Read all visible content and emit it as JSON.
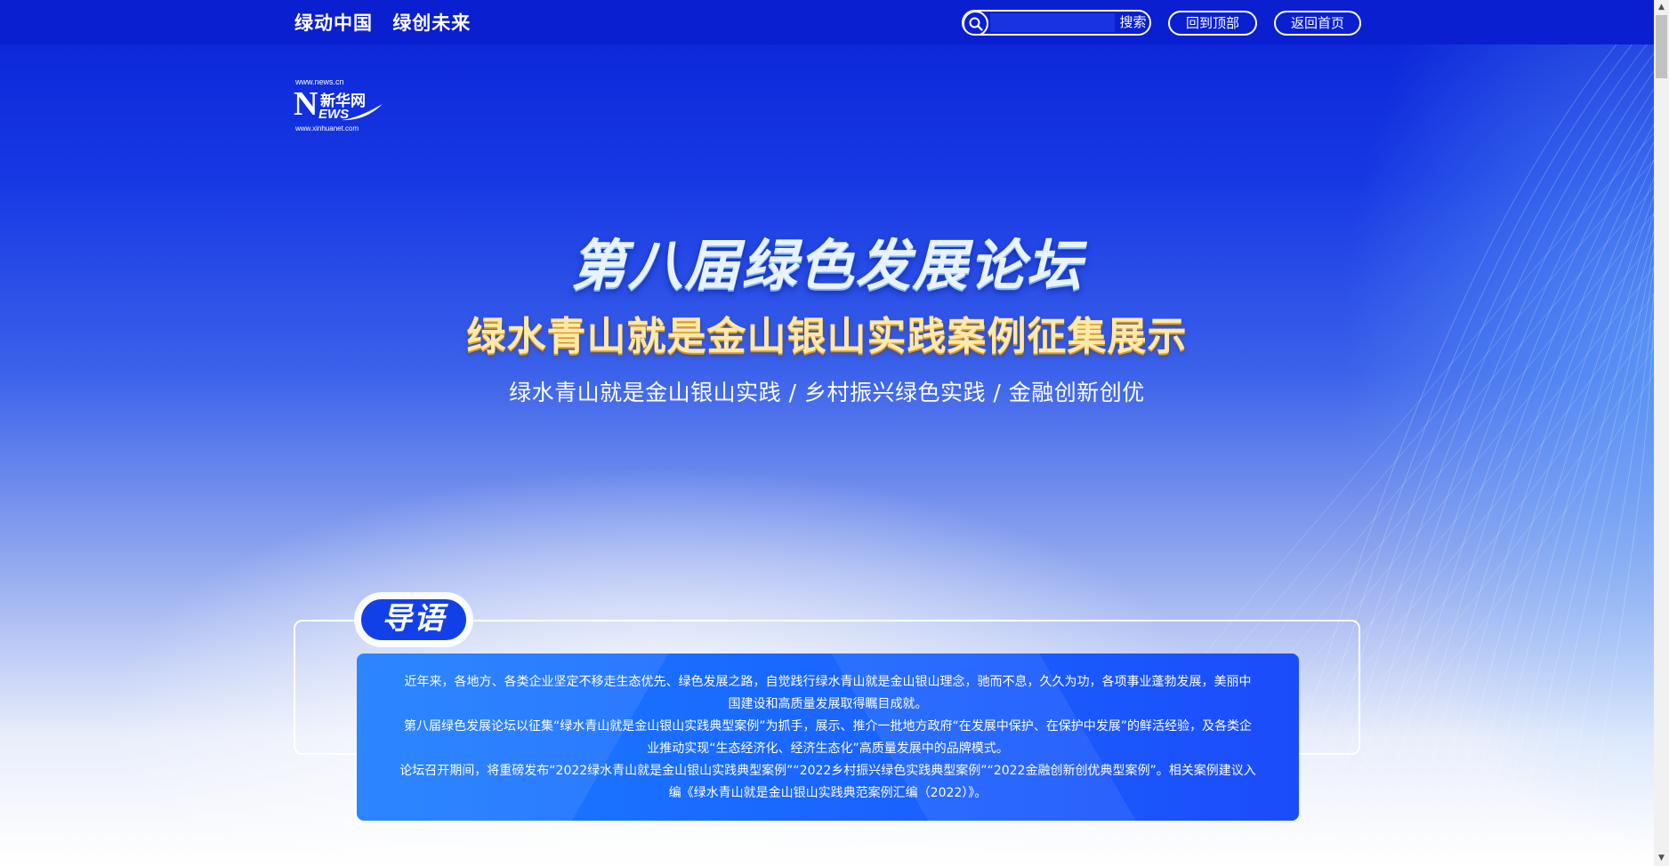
{
  "header": {
    "slogan": [
      "绿动中国",
      "绿创未来"
    ],
    "search": {
      "input_value": "",
      "button_label": "搜索"
    },
    "nav": {
      "back_to_top": "回到顶部",
      "back_home": "返回首页"
    }
  },
  "logo": {
    "url_top": "www.news.cn",
    "brand_letter": "N",
    "brand_name": "新华网",
    "brand_suffix": "EWS",
    "url_bottom": "www.xinhuanet.com"
  },
  "hero": {
    "title": "第八届绿色发展论坛",
    "subtitle": "绿水青山就是金山银山实践案例征集展示",
    "categories": "绿水青山就是金山银山实践 / 乡村振兴绿色实践 / 金融创新创优"
  },
  "intro": {
    "badge": "导语",
    "paragraphs": [
      "近年来，各地方、各类企业坚定不移走生态优先、绿色发展之路，自觉践行绿水青山就是金山银山理念，驰而不息，久久为功，各项事业蓬勃发展，美丽中国建设和高质量发展取得瞩目成就。",
      "第八届绿色发展论坛以征集“绿水青山就是金山银山实践典型案例”为抓手，展示、推介一批地方政府“在发展中保护、在保护中发展”的鲜活经验，及各类企业推动实现“生态经济化、经济生态化”高质量发展中的品牌模式。",
      "论坛召开期间，将重磅发布“2022绿水青山就是金山银山实践典型案例”“2022乡村振兴绿色实践典型案例”“2022金融创新创优典型案例”。相关案例建议入编《绿水青山就是金山银山实践典范案例汇编（2022）》。"
    ]
  },
  "colors": {
    "topbar": "#0a1fcf",
    "panel": "#1a66ff",
    "subtitle_gold": "#ffe9a8"
  },
  "icons": {
    "search": "search-icon",
    "scroll_up": "arrow-up-icon",
    "scroll_down": "arrow-down-icon"
  }
}
